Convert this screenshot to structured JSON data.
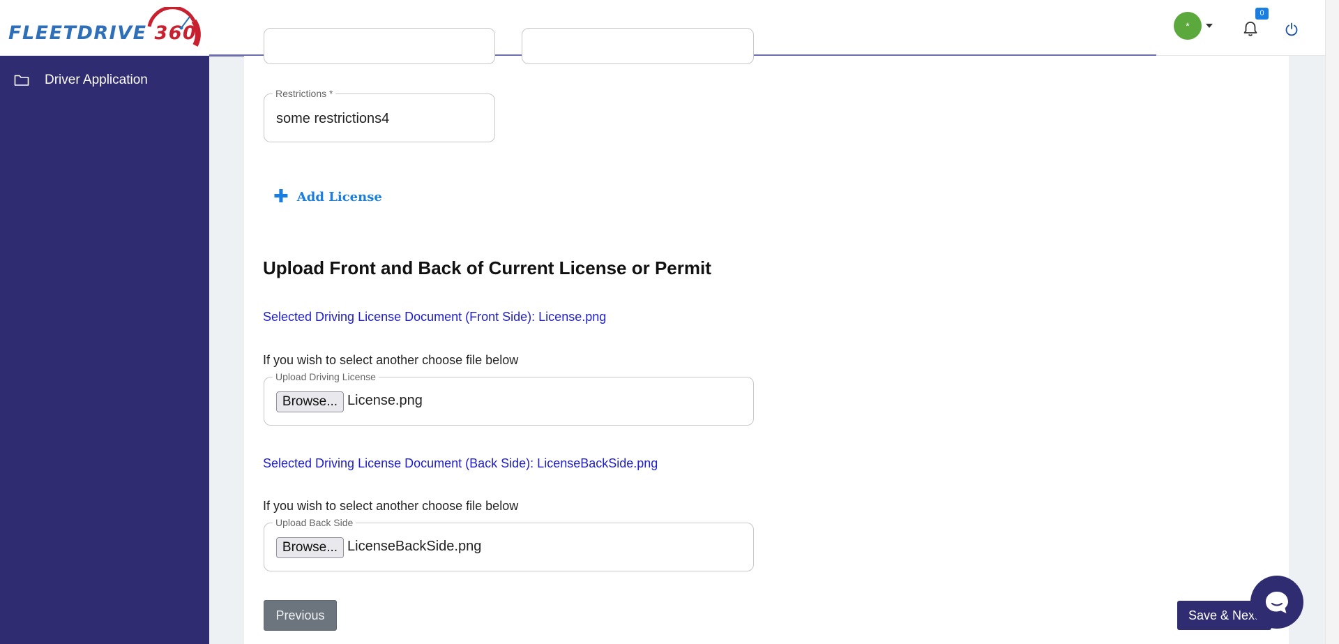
{
  "brand": {
    "logo_text": "FLEETDRIVE",
    "logo_number": "360"
  },
  "header": {
    "avatar_initial": "*",
    "notification_count": "0"
  },
  "sidebar": {
    "items": [
      {
        "label": "Driver Application",
        "icon": "folder-icon"
      }
    ]
  },
  "form": {
    "restrictions": {
      "label": "Restrictions *",
      "value": "some restrictions4"
    },
    "add_license_label": "Add License",
    "upload_section": {
      "title": "Upload Front and Back of Current License or Permit",
      "front": {
        "selected_text": "Selected Driving License Document (Front Side):  License.png",
        "hint": "If you wish to select another choose file below",
        "field_label": "Upload Driving License",
        "browse_label": "Browse...",
        "file_name": "License.png"
      },
      "back": {
        "selected_text": "Selected Driving License Document (Back Side):  LicenseBackSide.png",
        "hint": "If you wish to select another choose file below",
        "field_label": "Upload Back Side",
        "browse_label": "Browse...",
        "file_name": "LicenseBackSide.png"
      }
    }
  },
  "actions": {
    "previous_label": "Previous",
    "save_next_label": "Save & Next"
  },
  "colors": {
    "sidebar_bg": "#2f2c72",
    "accent_blue": "#1a7de0",
    "link_blue": "#2020c8",
    "avatar_green": "#5ba83c",
    "secondary_button": "#6c757d"
  }
}
